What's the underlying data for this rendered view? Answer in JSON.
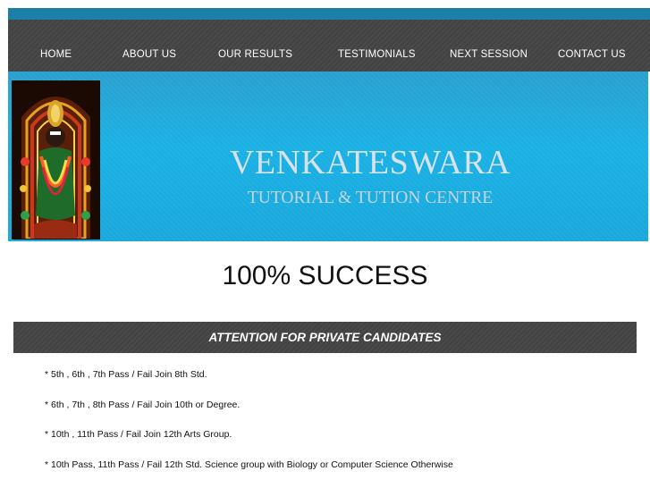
{
  "nav": {
    "items": [
      {
        "label": "HOME"
      },
      {
        "label": "ABOUT US"
      },
      {
        "label": "OUR RESULTS"
      },
      {
        "label": "TESTIMONIALS"
      },
      {
        "label": "NEXT SESSION"
      },
      {
        "label": "CONTACT US"
      }
    ]
  },
  "hero": {
    "title": "VENKATESWARA",
    "subtitle": "TUTORIAL & TUTION CENTRE"
  },
  "main": {
    "headline": "100% SUCCESS",
    "banner": "ATTENTION FOR PRIVATE CANDIDATES",
    "items": [
      "* 5th , 6th , 7th Pass / Fail Join 8th Std.",
      "* 6th , 7th , 8th Pass / Fail Join 10th or Degree.",
      "* 10th , 11th Pass / Fail Join 12th Arts Group.",
      "* 10th Pass, 11th Pass / Fail 12th Std. Science group with Biology or Computer Science Otherwise"
    ]
  },
  "colors": {
    "nav_bg": "#444444",
    "top_strip": "#1b7fa6",
    "hero_blue": "#1ab1e4",
    "hero_text": "#d7e2ea"
  }
}
